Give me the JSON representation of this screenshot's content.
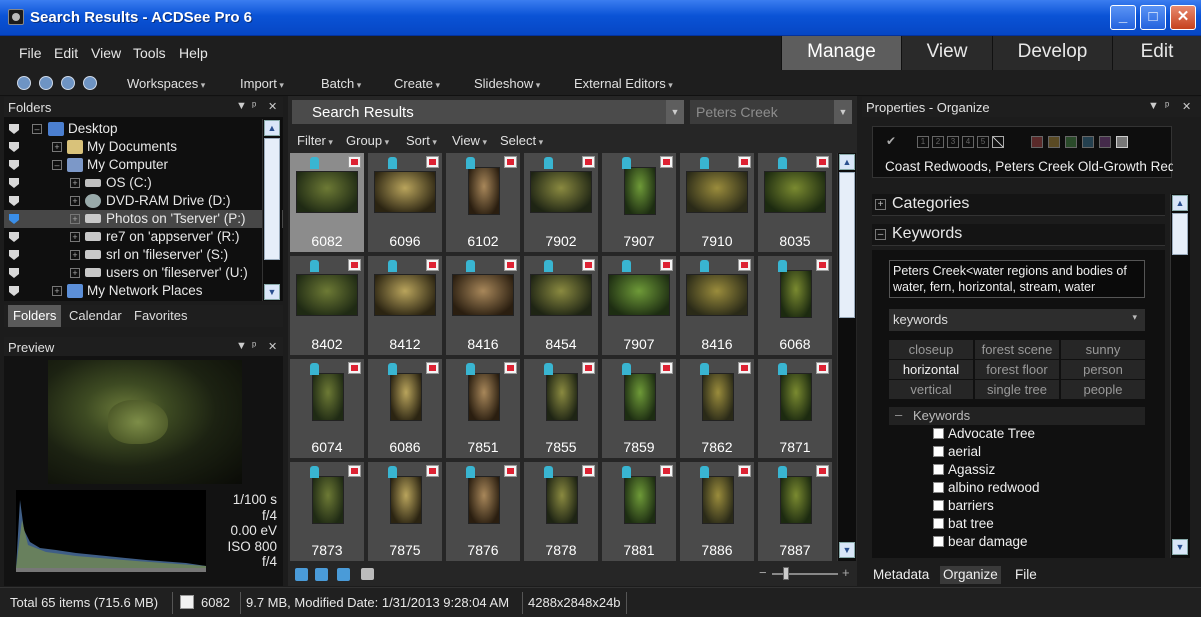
{
  "window": {
    "title": "Search Results - ACDSee Pro 6"
  },
  "menu": [
    "File",
    "Edit",
    "View",
    "Tools",
    "Help"
  ],
  "modes": [
    {
      "label": "Manage",
      "active": true
    },
    {
      "label": "View",
      "active": false
    },
    {
      "label": "Develop",
      "active": false
    },
    {
      "label": "Edit",
      "active": false
    }
  ],
  "toolbar": {
    "items": [
      "Workspaces",
      "Import",
      "Batch",
      "Create",
      "Slideshow",
      "External Editors"
    ]
  },
  "folders_panel": {
    "title": "Folders",
    "tree": [
      {
        "label": "Desktop",
        "selected": false
      },
      {
        "label": "My Documents",
        "selected": false
      },
      {
        "label": "My Computer",
        "selected": false
      },
      {
        "label": "OS (C:)",
        "selected": false
      },
      {
        "label": "DVD-RAM Drive (D:)",
        "selected": false
      },
      {
        "label": "Photos on 'Tserver' (P:)",
        "selected": true
      },
      {
        "label": "re7 on 'appserver' (R:)",
        "selected": false
      },
      {
        "label": "srl on 'fileserver' (S:)",
        "selected": false
      },
      {
        "label": "users on 'fileserver' (U:)",
        "selected": false
      },
      {
        "label": "My Network Places",
        "selected": false
      }
    ],
    "tabs": [
      {
        "label": "Folders",
        "active": true
      },
      {
        "label": "Calendar",
        "active": false
      },
      {
        "label": "Favorites",
        "active": false
      }
    ]
  },
  "preview_panel": {
    "title": "Preview",
    "exif": [
      "1/100 s",
      "f/4",
      "0.00 eV",
      "ISO 800",
      "f/4"
    ]
  },
  "center": {
    "search_label": "Search Results",
    "criteria_value": "Peters Creek",
    "filter_items": [
      "Filter",
      "Group",
      "Sort",
      "View",
      "Select"
    ],
    "thumbnails": [
      "6082",
      "6096",
      "6102",
      "7902",
      "7907",
      "7910",
      "8035",
      "8402",
      "8412",
      "8416",
      "8454",
      "7907",
      "8416",
      "6068",
      "6074",
      "6086",
      "7851",
      "7855",
      "7859",
      "7862",
      "7871",
      "7873",
      "7875",
      "7876",
      "7878",
      "7881",
      "7886",
      "7887"
    ],
    "selected_index": 0
  },
  "properties_panel": {
    "title": "Properties - Organize",
    "rating_labels": [
      "1",
      "2",
      "3",
      "4",
      "5"
    ],
    "caption": "Coast Redwoods, Peters Creek Old-Growth Redw",
    "categories_label": "Categories",
    "keywords_label": "Keywords",
    "keywords_text": "Peters Creek<water regions and bodies of water, fern, horizontal, stream, water",
    "keyword_set_select": "keywords",
    "quick_keywords": [
      {
        "label": "closeup",
        "on": false
      },
      {
        "label": "forest scene",
        "on": false
      },
      {
        "label": "sunny",
        "on": false
      },
      {
        "label": "horizontal",
        "on": true
      },
      {
        "label": "forest floor",
        "on": false
      },
      {
        "label": "person",
        "on": false
      },
      {
        "label": "vertical",
        "on": false
      },
      {
        "label": "single tree",
        "on": false
      },
      {
        "label": "people",
        "on": false
      }
    ],
    "keyword_tree_title": "Keywords",
    "keyword_tree": [
      "Advocate Tree",
      "aerial",
      "Agassiz",
      "albino redwood",
      "barriers",
      "bat tree",
      "bear damage"
    ],
    "tabs": [
      {
        "label": "Metadata",
        "active": false
      },
      {
        "label": "Organize",
        "active": true
      },
      {
        "label": "File",
        "active": false
      }
    ]
  },
  "statusbar": {
    "total": "Total 65 items  (715.6 MB)",
    "current": "6082",
    "info": "9.7 MB, Modified Date: 1/31/2013 9:28:04 AM",
    "dims": "4288x2848x24b"
  }
}
